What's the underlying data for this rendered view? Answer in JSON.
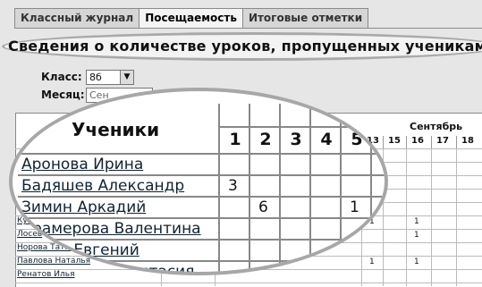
{
  "tabs": [
    "Классный журнал",
    "Посещаемость",
    "Итоговые отметки"
  ],
  "heading": "Сведения о количестве уроков, пропущенных учениками",
  "class_label": "Класс:",
  "class_value": "8б",
  "month_label": "Месяц:",
  "month_value": "Сен",
  "students_header": "Ученики",
  "month_name": "Сентябрь",
  "big_days": [
    "1",
    "2",
    "3",
    "4",
    "5"
  ],
  "small_days": [
    "13",
    "15",
    "16",
    "17",
    "18"
  ],
  "big_students": [
    {
      "name": "Аронова Ирина",
      "marks": [
        "",
        "",
        "",
        "",
        ""
      ]
    },
    {
      "name": "Бадяшев Александр",
      "marks": [
        "3",
        "",
        "",
        "",
        ""
      ]
    },
    {
      "name": "Зимин Аркадий",
      "marks": [
        "",
        "6",
        "",
        "",
        "1"
      ]
    },
    {
      "name": "Крамерова Валентина",
      "marks": [
        "",
        "",
        "",
        "",
        ""
      ]
    },
    {
      "name": "Лосев Евгений",
      "marks": [
        "",
        "",
        "",
        "",
        ""
      ]
    },
    {
      "name": "Анастасия",
      "marks": [
        "",
        "",
        "",
        "",
        ""
      ]
    }
  ],
  "small_students": [
    "Ку...",
    "Лосев",
    "Норова Тат...",
    "Павлова Наталья",
    "Ренатов Илья"
  ],
  "small_marks": [
    {
      "row": 1,
      "col": 0,
      "v": "1"
    },
    {
      "row": 1,
      "col": 2,
      "v": "1"
    },
    {
      "row": 2,
      "col": 2,
      "v": "1"
    },
    {
      "row": 4,
      "col": 0,
      "v": "1"
    },
    {
      "row": 4,
      "col": 2,
      "v": "1"
    }
  ]
}
